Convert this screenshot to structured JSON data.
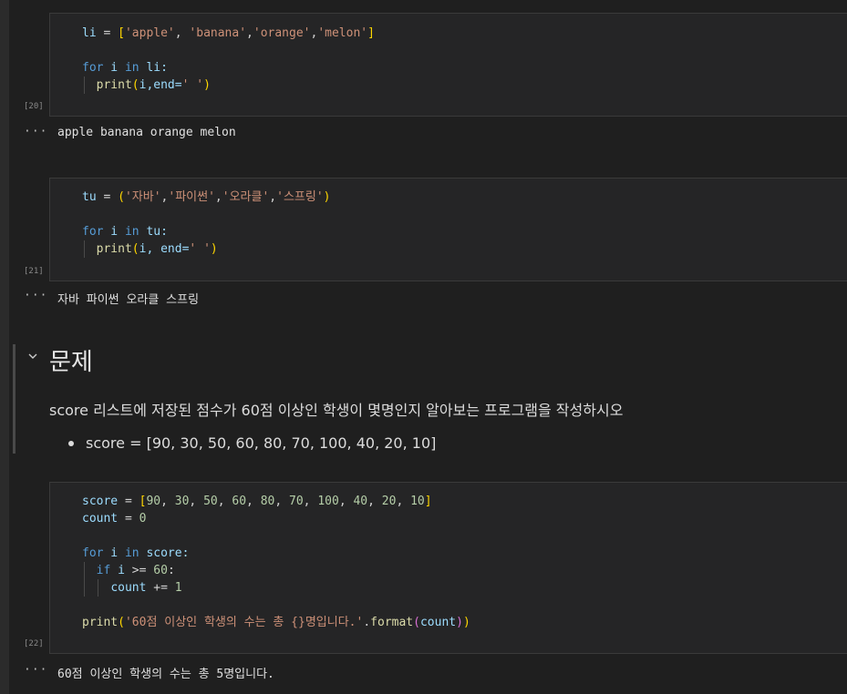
{
  "cells": [
    {
      "exec_count": "[20]",
      "lines": [
        [
          {
            "t": "li",
            "c": "var"
          },
          {
            "t": " = ",
            "c": "op"
          },
          {
            "t": "[",
            "c": "br1"
          },
          {
            "t": "'apple'",
            "c": "str"
          },
          {
            "t": ", ",
            "c": "op"
          },
          {
            "t": "'banana'",
            "c": "str"
          },
          {
            "t": ",",
            "c": "op"
          },
          {
            "t": "'orange'",
            "c": "str"
          },
          {
            "t": ",",
            "c": "op"
          },
          {
            "t": "'melon'",
            "c": "str"
          },
          {
            "t": "]",
            "c": "br1"
          }
        ],
        [],
        [
          {
            "t": "for",
            "c": "kw"
          },
          {
            "t": " i ",
            "c": "var"
          },
          {
            "t": "in",
            "c": "kw"
          },
          {
            "t": " li:",
            "c": "var"
          }
        ],
        [
          {
            "t": "  ",
            "c": "op"
          },
          {
            "t": "print",
            "c": "fn"
          },
          {
            "t": "(",
            "c": "br1"
          },
          {
            "t": "i,end=",
            "c": "var"
          },
          {
            "t": "' '",
            "c": "str"
          },
          {
            "t": ")",
            "c": "br1"
          }
        ]
      ],
      "output": "apple banana orange melon"
    },
    {
      "exec_count": "[21]",
      "lines": [
        [
          {
            "t": "tu",
            "c": "var"
          },
          {
            "t": " = ",
            "c": "op"
          },
          {
            "t": "(",
            "c": "br1"
          },
          {
            "t": "'자바'",
            "c": "str"
          },
          {
            "t": ",",
            "c": "op"
          },
          {
            "t": "'파이썬'",
            "c": "str"
          },
          {
            "t": ",",
            "c": "op"
          },
          {
            "t": "'오라클'",
            "c": "str"
          },
          {
            "t": ",",
            "c": "op"
          },
          {
            "t": "'스프링'",
            "c": "str"
          },
          {
            "t": ")",
            "c": "br1"
          }
        ],
        [],
        [
          {
            "t": "for",
            "c": "kw"
          },
          {
            "t": " i ",
            "c": "var"
          },
          {
            "t": "in",
            "c": "kw"
          },
          {
            "t": " tu:",
            "c": "var"
          }
        ],
        [
          {
            "t": "  ",
            "c": "op"
          },
          {
            "t": "print",
            "c": "fn"
          },
          {
            "t": "(",
            "c": "br1"
          },
          {
            "t": "i, end=",
            "c": "var"
          },
          {
            "t": "' '",
            "c": "str"
          },
          {
            "t": ")",
            "c": "br1"
          }
        ]
      ],
      "output": "자바 파이썬 오라클 스프링"
    },
    {
      "exec_count": "[22]",
      "lines": [
        [
          {
            "t": "score",
            "c": "var"
          },
          {
            "t": " = ",
            "c": "op"
          },
          {
            "t": "[",
            "c": "br1"
          },
          {
            "t": "90",
            "c": "num"
          },
          {
            "t": ", ",
            "c": "op"
          },
          {
            "t": "30",
            "c": "num"
          },
          {
            "t": ", ",
            "c": "op"
          },
          {
            "t": "50",
            "c": "num"
          },
          {
            "t": ", ",
            "c": "op"
          },
          {
            "t": "60",
            "c": "num"
          },
          {
            "t": ", ",
            "c": "op"
          },
          {
            "t": "80",
            "c": "num"
          },
          {
            "t": ", ",
            "c": "op"
          },
          {
            "t": "70",
            "c": "num"
          },
          {
            "t": ", ",
            "c": "op"
          },
          {
            "t": "100",
            "c": "num"
          },
          {
            "t": ", ",
            "c": "op"
          },
          {
            "t": "40",
            "c": "num"
          },
          {
            "t": ", ",
            "c": "op"
          },
          {
            "t": "20",
            "c": "num"
          },
          {
            "t": ", ",
            "c": "op"
          },
          {
            "t": "10",
            "c": "num"
          },
          {
            "t": "]",
            "c": "br1"
          }
        ],
        [
          {
            "t": "count",
            "c": "var"
          },
          {
            "t": " = ",
            "c": "op"
          },
          {
            "t": "0",
            "c": "num"
          }
        ],
        [],
        [
          {
            "t": "for",
            "c": "kw"
          },
          {
            "t": " i ",
            "c": "var"
          },
          {
            "t": "in",
            "c": "kw"
          },
          {
            "t": " score:",
            "c": "var"
          }
        ],
        [
          {
            "t": "  ",
            "c": "op"
          },
          {
            "t": "if",
            "c": "kw"
          },
          {
            "t": " i ",
            "c": "var"
          },
          {
            "t": ">=",
            "c": "op"
          },
          {
            "t": " ",
            "c": "op"
          },
          {
            "t": "60",
            "c": "num"
          },
          {
            "t": ":",
            "c": "op"
          }
        ],
        [
          {
            "t": "    ",
            "c": "op"
          },
          {
            "t": "count",
            "c": "var"
          },
          {
            "t": " += ",
            "c": "op"
          },
          {
            "t": "1",
            "c": "num"
          }
        ],
        [],
        [
          {
            "t": "print",
            "c": "fn"
          },
          {
            "t": "(",
            "c": "br1"
          },
          {
            "t": "'60점 이상인 학생의 수는 총 {}명입니다.'",
            "c": "str"
          },
          {
            "t": ".",
            "c": "op"
          },
          {
            "t": "format",
            "c": "fn"
          },
          {
            "t": "(",
            "c": "br2"
          },
          {
            "t": "count",
            "c": "var"
          },
          {
            "t": ")",
            "c": "br2"
          },
          {
            "t": ")",
            "c": "br1"
          }
        ]
      ],
      "output": "60점 이상인 학생의 수는 총 5명입니다."
    }
  ],
  "markdown": {
    "heading": "문제",
    "paragraph": "score 리스트에 저장된 점수가 60점 이상인 학생이 몇명인지 알아보는 프로그램을 작성하시오",
    "bullet": "score = [90, 30, 50, 60, 80, 70, 100, 40, 20, 10]"
  },
  "output_marker": "···",
  "colors": {
    "keyword": "#569cd6",
    "string": "#ce9178",
    "number": "#b5cea8",
    "function": "#dcdcaa",
    "bracket1": "#ffd700",
    "bracket2": "#da70d6",
    "background": "#1f1f1f",
    "cell_background": "#252526"
  }
}
